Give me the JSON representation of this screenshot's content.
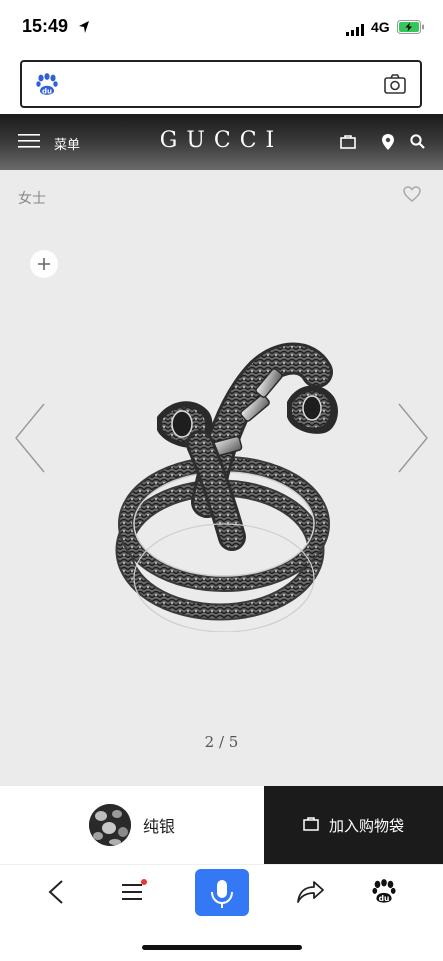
{
  "status": {
    "time": "15:49",
    "network": "4G"
  },
  "search": {
    "value": ""
  },
  "header": {
    "menu_label": "菜单",
    "brand": "GUCCI"
  },
  "product": {
    "category": "女士",
    "image_counter": "2 / 5"
  },
  "cta": {
    "material_label": "纯银",
    "add_to_bag_label": "加入购物袋"
  },
  "colors": {
    "mic_accent": "#3478f6",
    "baidu_blue": "#3060d8",
    "notification_dot": "#e53935"
  }
}
